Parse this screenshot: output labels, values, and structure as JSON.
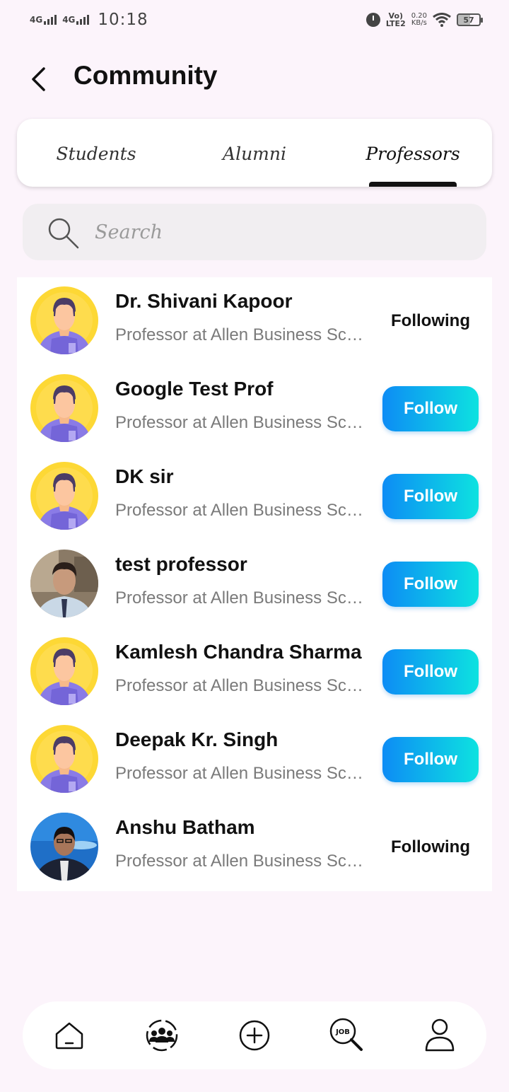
{
  "status_bar": {
    "network1": "4G",
    "network2": "4G",
    "time": "10:18",
    "volte": "Vo)",
    "lte": "LTE2",
    "speed_value": "0.20",
    "speed_unit": "KB/s",
    "battery": "57"
  },
  "header": {
    "title": "Community"
  },
  "tabs": [
    {
      "label": "Students",
      "active": false
    },
    {
      "label": "Alumni",
      "active": false
    },
    {
      "label": "Professors",
      "active": true
    }
  ],
  "search": {
    "placeholder": "Search"
  },
  "people": [
    {
      "name": "Dr. Shivani Kapoor",
      "subtitle": "Professor at Allen Business School",
      "action": "Following",
      "avatar": "default"
    },
    {
      "name": "Google Test Prof",
      "subtitle": "Professor at Allen Business School",
      "action": "Follow",
      "avatar": "default"
    },
    {
      "name": "DK sir",
      "subtitle": "Professor at Allen Business School",
      "action": "Follow",
      "avatar": "default"
    },
    {
      "name": "test professor",
      "subtitle": "Professor at Allen Business School",
      "action": "Follow",
      "avatar": "photo"
    },
    {
      "name": "Kamlesh Chandra Sharma",
      "subtitle": "Professor at Allen Business School",
      "action": "Follow",
      "avatar": "default"
    },
    {
      "name": "Deepak Kr. Singh",
      "subtitle": "Professor at Allen Business School",
      "action": "Follow",
      "avatar": "default"
    },
    {
      "name": "Anshu Batham",
      "subtitle": "Professor at Allen Business School",
      "action": "Following",
      "avatar": "photo"
    }
  ],
  "bottom_nav": [
    {
      "icon": "home-icon"
    },
    {
      "icon": "community-icon"
    },
    {
      "icon": "add-icon"
    },
    {
      "icon": "job-search-icon"
    },
    {
      "icon": "profile-icon"
    }
  ],
  "colors": {
    "background": "#fcf4fb",
    "follow_gradient_start": "#0d8cf5",
    "follow_gradient_end": "#0de2e0",
    "avatar_yellow": "#fdd835",
    "avatar_purple": "#7c6ee0"
  }
}
